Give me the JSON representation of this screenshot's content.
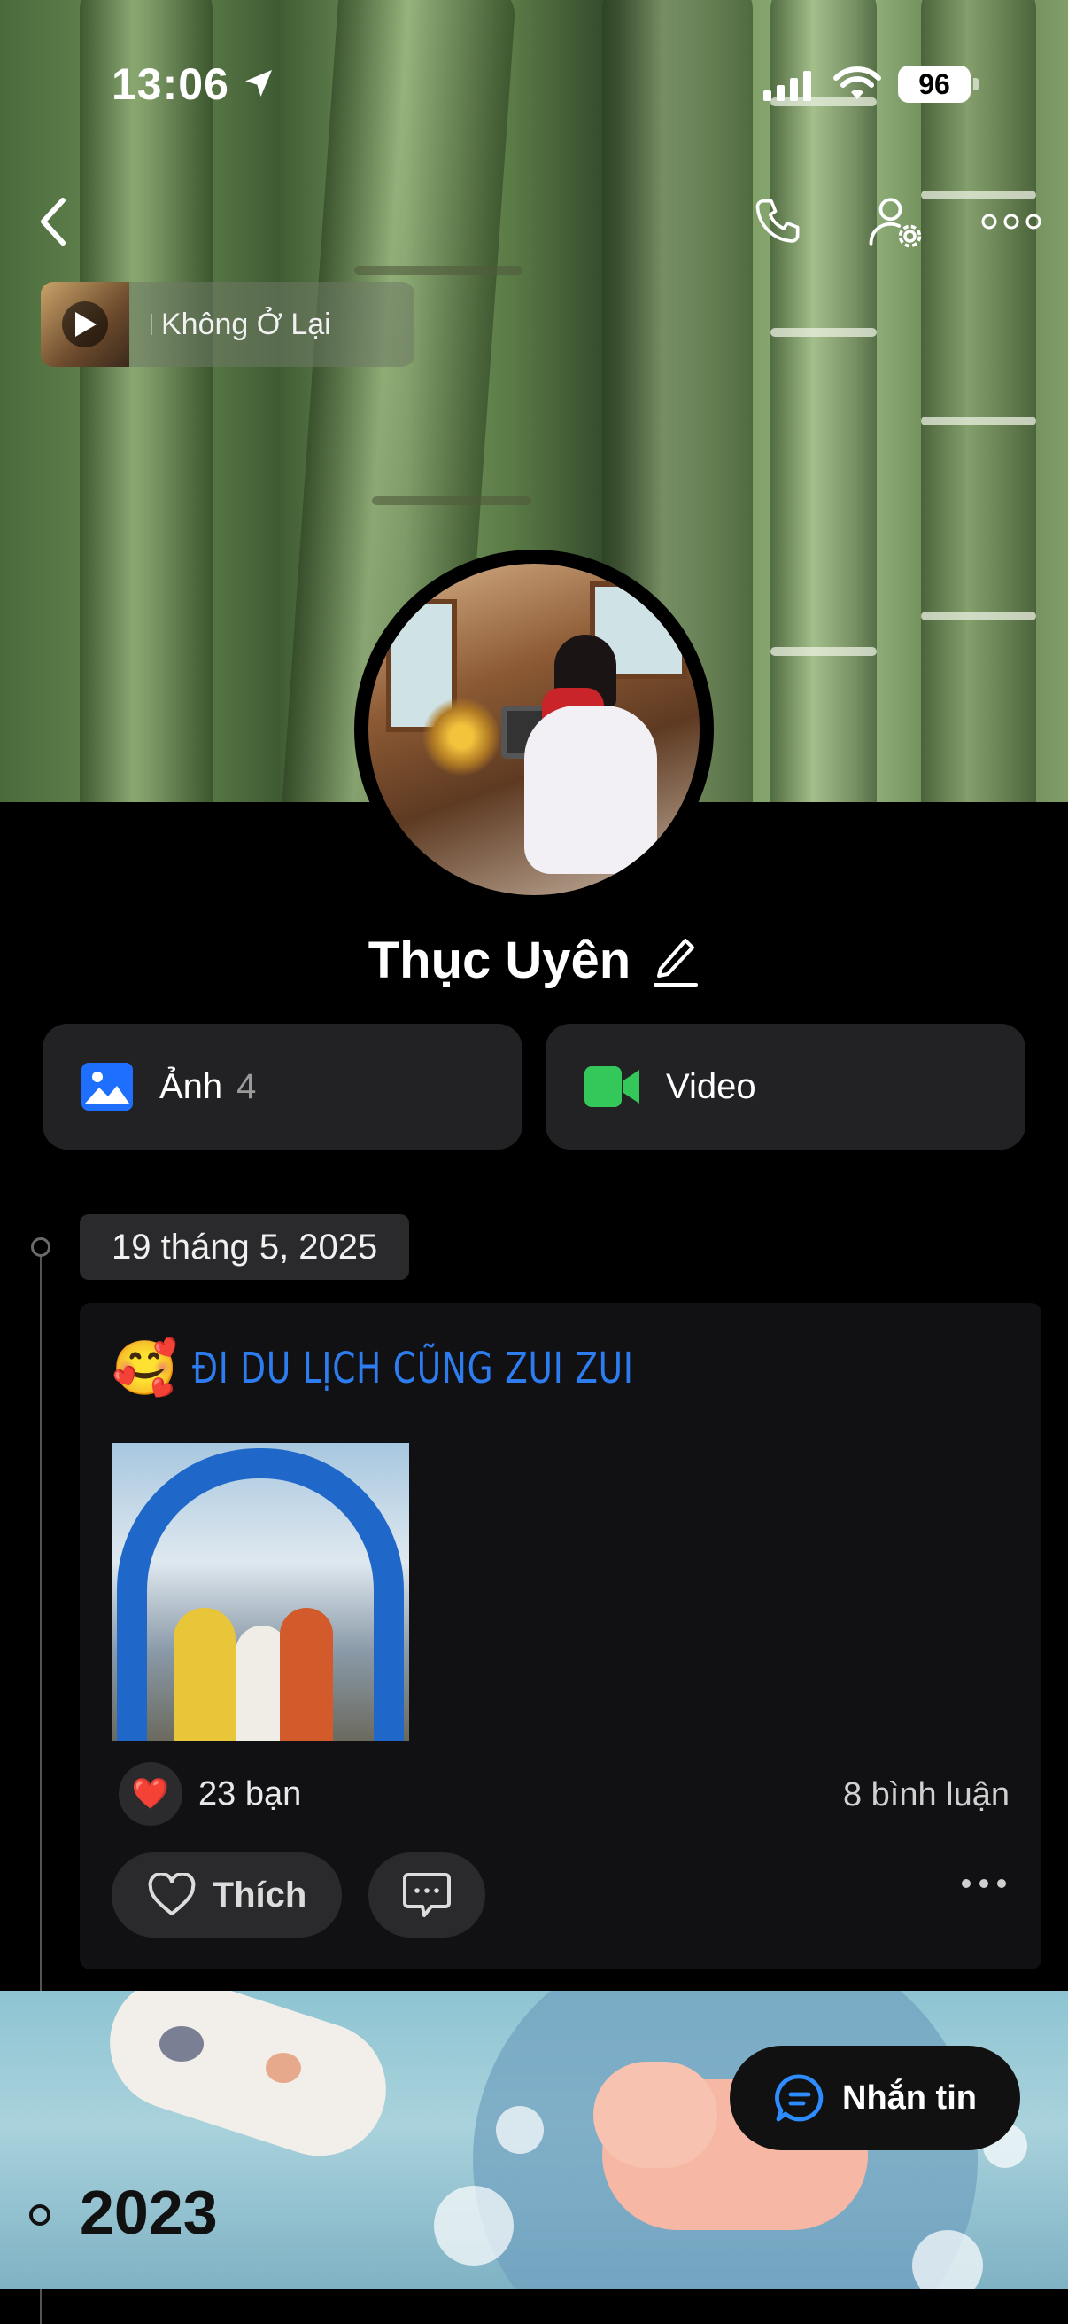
{
  "status_bar": {
    "time": "13:06",
    "battery": "96"
  },
  "music": {
    "title": "Không Ở Lại"
  },
  "profile": {
    "name": "Thục Uyên"
  },
  "media": {
    "photos_label": "Ảnh",
    "photos_count": "4",
    "video_label": "Video"
  },
  "timeline": {
    "date": "19 tháng 5, 2025",
    "year": "2023"
  },
  "post": {
    "emoji": "🥰",
    "text": "ĐI DU LỊCH CŨNG ZUI ZUI",
    "reaction_emoji": "❤️",
    "likes": "23 bạn",
    "comments": "8 bình luận",
    "like_label": "Thích"
  },
  "message_button": {
    "label": "Nhắn tin"
  },
  "colors": {
    "accent_blue": "#2d7cf0",
    "video_green": "#34c759",
    "photo_blue": "#1f6fff"
  },
  "icons": [
    "location-arrow-icon",
    "signal-icon",
    "wifi-icon",
    "back-icon",
    "phone-icon",
    "user-settings-icon",
    "more-icon",
    "play-icon",
    "edit-icon",
    "photo-icon",
    "video-icon",
    "heart-icon",
    "comment-icon",
    "message-icon"
  ]
}
